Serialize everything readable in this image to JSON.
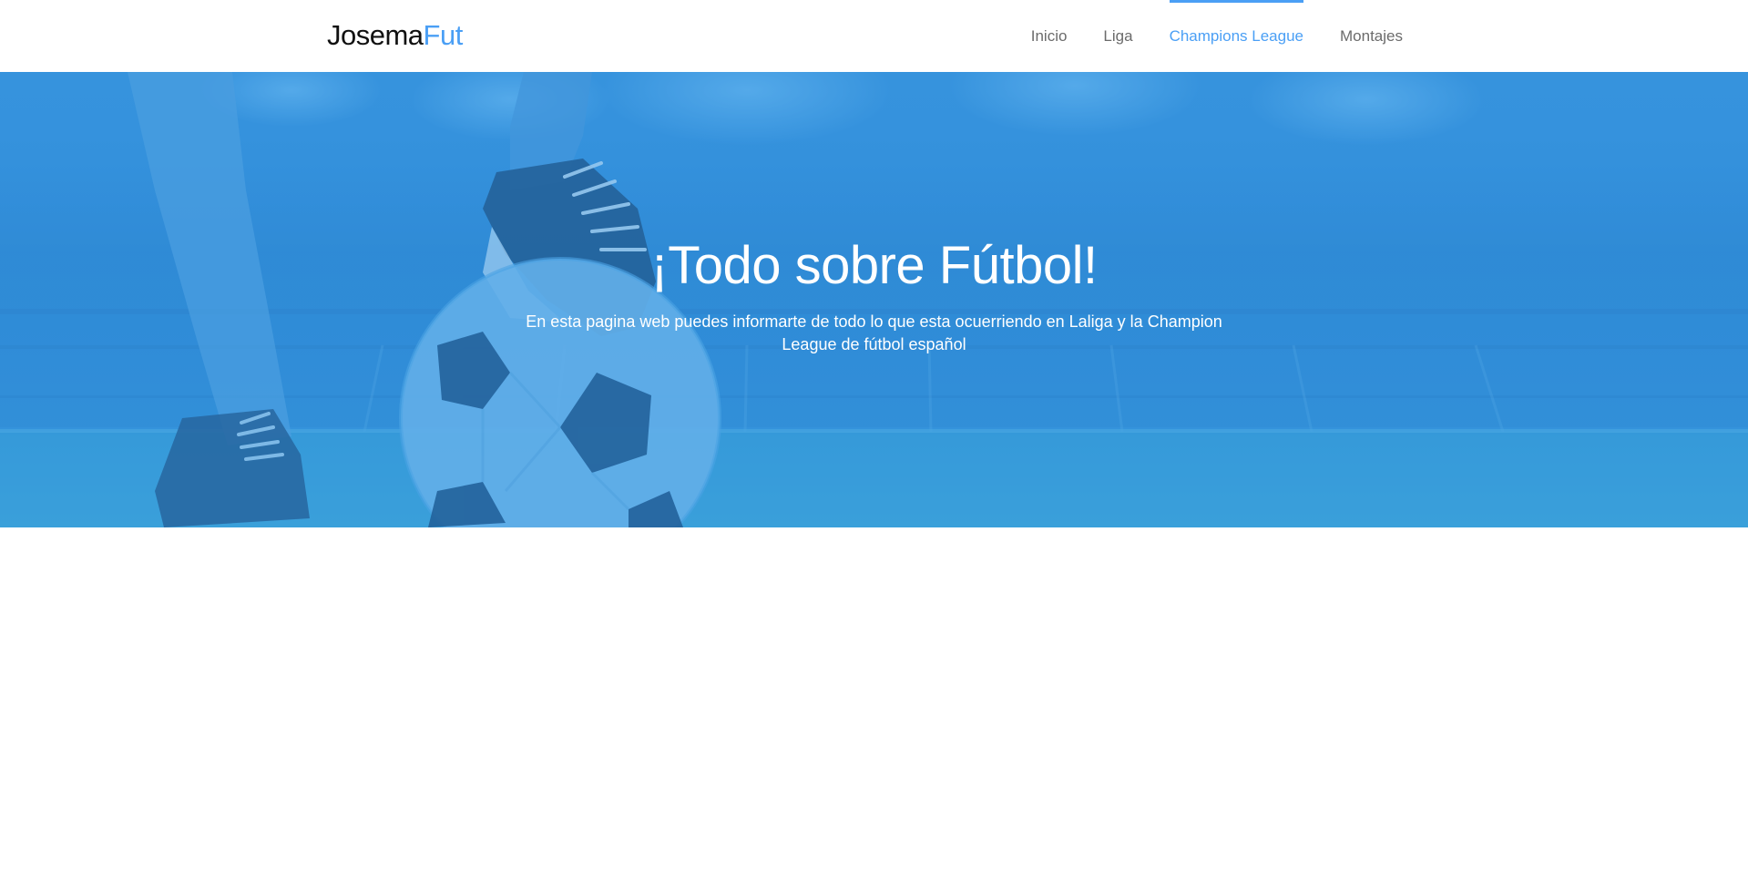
{
  "header": {
    "brand_primary": "Josema",
    "brand_accent": "Fut",
    "nav": [
      {
        "label": "Inicio",
        "active": false
      },
      {
        "label": "Liga",
        "active": false
      },
      {
        "label": "Champions League",
        "active": true
      },
      {
        "label": "Montajes",
        "active": false
      }
    ]
  },
  "hero": {
    "title": "¡Todo sobre Fútbol!",
    "subtitle": "En esta pagina web puedes informarte de todo lo que esta ocuerriendo en Laliga y la Champion League de fútbol español"
  },
  "colors": {
    "accent": "#4a9ff5",
    "hero_blue": "#3692dc",
    "nav_text": "#6b6b6b",
    "brand_text": "#111111"
  },
  "icons": {
    "hero_image": "football-player-ball-stadium-image"
  }
}
